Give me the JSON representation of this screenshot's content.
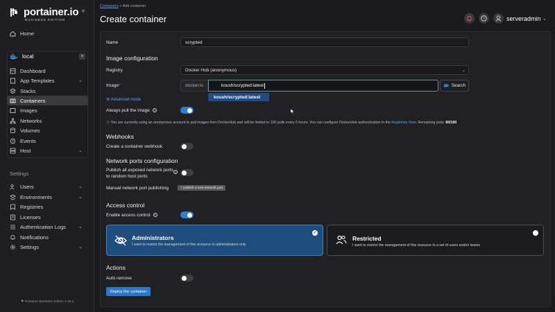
{
  "brand": {
    "name": "portainer.io",
    "edition": "BUSINESS EDITION"
  },
  "sidebar": {
    "home": "Home",
    "environment": "local",
    "env_items": [
      {
        "label": "Dashboard"
      },
      {
        "label": "App Templates"
      },
      {
        "label": "Stacks"
      },
      {
        "label": "Containers"
      },
      {
        "label": "Images"
      },
      {
        "label": "Networks"
      },
      {
        "label": "Volumes"
      },
      {
        "label": "Events"
      },
      {
        "label": "Host"
      }
    ],
    "settings_label": "Settings",
    "settings_items": [
      {
        "label": "Users"
      },
      {
        "label": "Environments"
      },
      {
        "label": "Registries"
      },
      {
        "label": "Licenses"
      },
      {
        "label": "Authentication Logs"
      },
      {
        "label": "Notifications"
      },
      {
        "label": "Settings"
      }
    ],
    "footer": "Portainer Business Edition 2.18.2"
  },
  "header": {
    "breadcrumb_link": "Containers",
    "breadcrumb_rest": "> Add container",
    "title": "Create container",
    "user": "serveradmin"
  },
  "form": {
    "name_label": "Name",
    "name_value": "scrypted",
    "image_config_heading": "Image configuration",
    "registry_label": "Registry",
    "registry_value": "Docker Hub (anonymous)",
    "image_label": "Image",
    "image_prefix": "docker.io",
    "image_value": "koush/scrypted:latest",
    "suggestion": "koush/scrypted:latest",
    "search_label": "Search",
    "advanced_mode": "Advanced mode",
    "always_pull_label": "Always pull the image",
    "always_pull": true,
    "info_text": "You are currently using an anonymous account to pull images from DockerHub and will be limited to 100 pulls every 6 hours. You can configure DockerHub authentication in the",
    "info_link": "Registries View",
    "info_remaining": ". Remaining pulls:",
    "info_count": "60/100",
    "webhooks_heading": "Webhooks",
    "webhook_label": "Create a container webhook",
    "webhook": false,
    "network_heading": "Network ports configuration",
    "publish_all_label_1": "Publish all exposed network ports",
    "publish_all_label_2": "to random host ports",
    "publish_all": false,
    "manual_publish_label": "Manual network port publishing",
    "manual_publish_pill": "+ publish a new network port",
    "access_heading": "Access control",
    "enable_access_label": "Enable access control",
    "enable_access": true,
    "admin_title": "Administrators",
    "admin_desc": "I want to restrict the management of this resource to administrators only",
    "restricted_title": "Restricted",
    "restricted_desc": "I want to restrict the management of this resource to a set of users and/or teams",
    "actions_heading": "Actions",
    "auto_remove_label": "Auto remove",
    "auto_remove": false,
    "deploy_label": "Deploy the container"
  },
  "colors": {
    "accent": "#2d7fd4",
    "admin_card": "#1d4e7d",
    "link": "#5ea2f0"
  }
}
